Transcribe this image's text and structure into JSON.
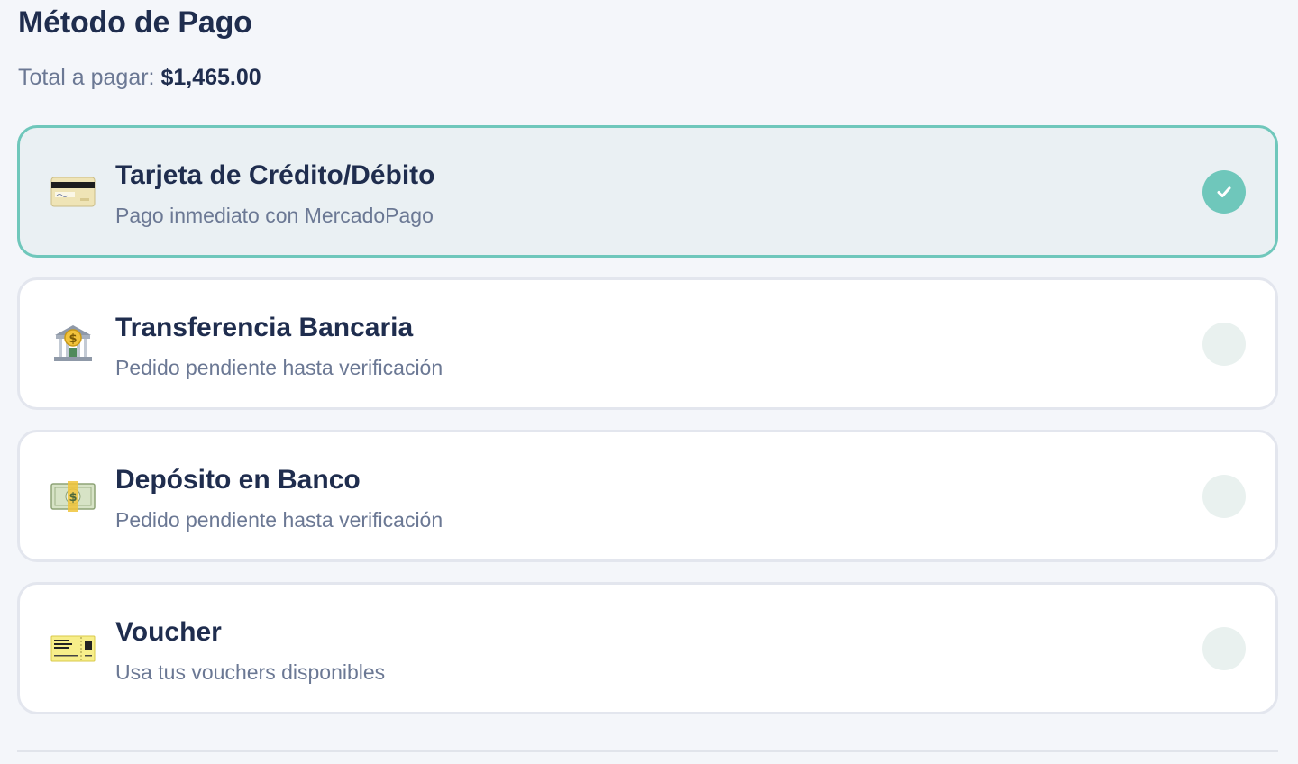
{
  "header": {
    "title": "Método de Pago",
    "total_label": "Total a pagar:",
    "total_amount": "$1,465.00"
  },
  "payment_methods": [
    {
      "icon": "credit-card-icon",
      "title": "Tarjeta de Crédito/Débito",
      "description": "Pago inmediato con MercadoPago",
      "selected": true
    },
    {
      "icon": "bank-icon",
      "title": "Transferencia Bancaria",
      "description": "Pedido pendiente hasta verificación",
      "selected": false
    },
    {
      "icon": "banknote-icon",
      "title": "Depósito en Banco",
      "description": "Pedido pendiente hasta verificación",
      "selected": false
    },
    {
      "icon": "ticket-icon",
      "title": "Voucher",
      "description": "Usa tus vouchers disponibles",
      "selected": false
    }
  ],
  "colors": {
    "accent": "#6fc7bb",
    "text_primary": "#1f2d4e",
    "text_secondary": "#6b7894",
    "background": "#f4f6fa",
    "selected_background": "#eaf0f3",
    "border": "#e3e6ee"
  }
}
